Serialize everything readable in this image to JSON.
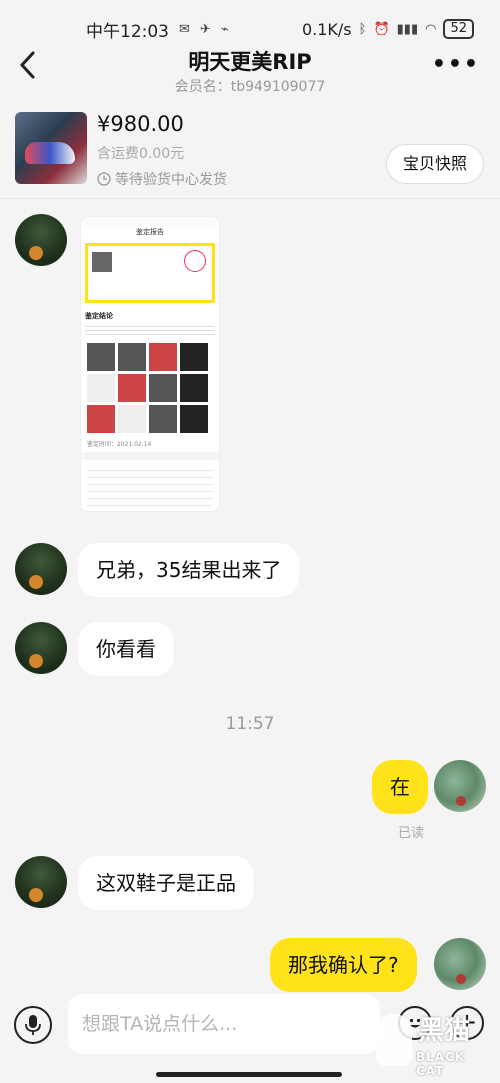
{
  "status_bar": {
    "time": "中午12:03",
    "network_speed": "0.1K/s",
    "battery": "52"
  },
  "header": {
    "title": "明天更美RIP",
    "member_id": "会员名：tb949109077"
  },
  "product": {
    "price": "¥980.00",
    "shipping": "含运费0.00元",
    "status": "等待验货中心发货",
    "snapshot_button": "宝贝快照"
  },
  "report_image": {
    "header": "鉴定报告",
    "section_title": "鉴定结论",
    "date": "鉴定时间：2021.02.14"
  },
  "messages": [
    {
      "sender": "other",
      "text": "兄弟，35结果出来了"
    },
    {
      "sender": "other",
      "text": "你看看"
    },
    {
      "sender": "me",
      "text": "在"
    },
    {
      "sender": "other",
      "text": "这双鞋子是正品"
    },
    {
      "sender": "me",
      "text": "那我确认了?"
    }
  ],
  "timestamp": "11:57",
  "read_receipt": "已读",
  "input": {
    "placeholder": "想跟TA说点什么..."
  },
  "watermark": {
    "cn": "黑猫",
    "en": "BLACK CAT"
  },
  "icons": {
    "back": "chevron-left-icon",
    "more": "more-dots-icon",
    "mic": "microphone-icon",
    "emoji": "emoji-icon",
    "plus": "plus-icon",
    "clock": "clock-icon"
  },
  "colors": {
    "my_bubble": "#ffe21a",
    "other_bubble": "#ffffff",
    "background": "#f4f4f4"
  }
}
